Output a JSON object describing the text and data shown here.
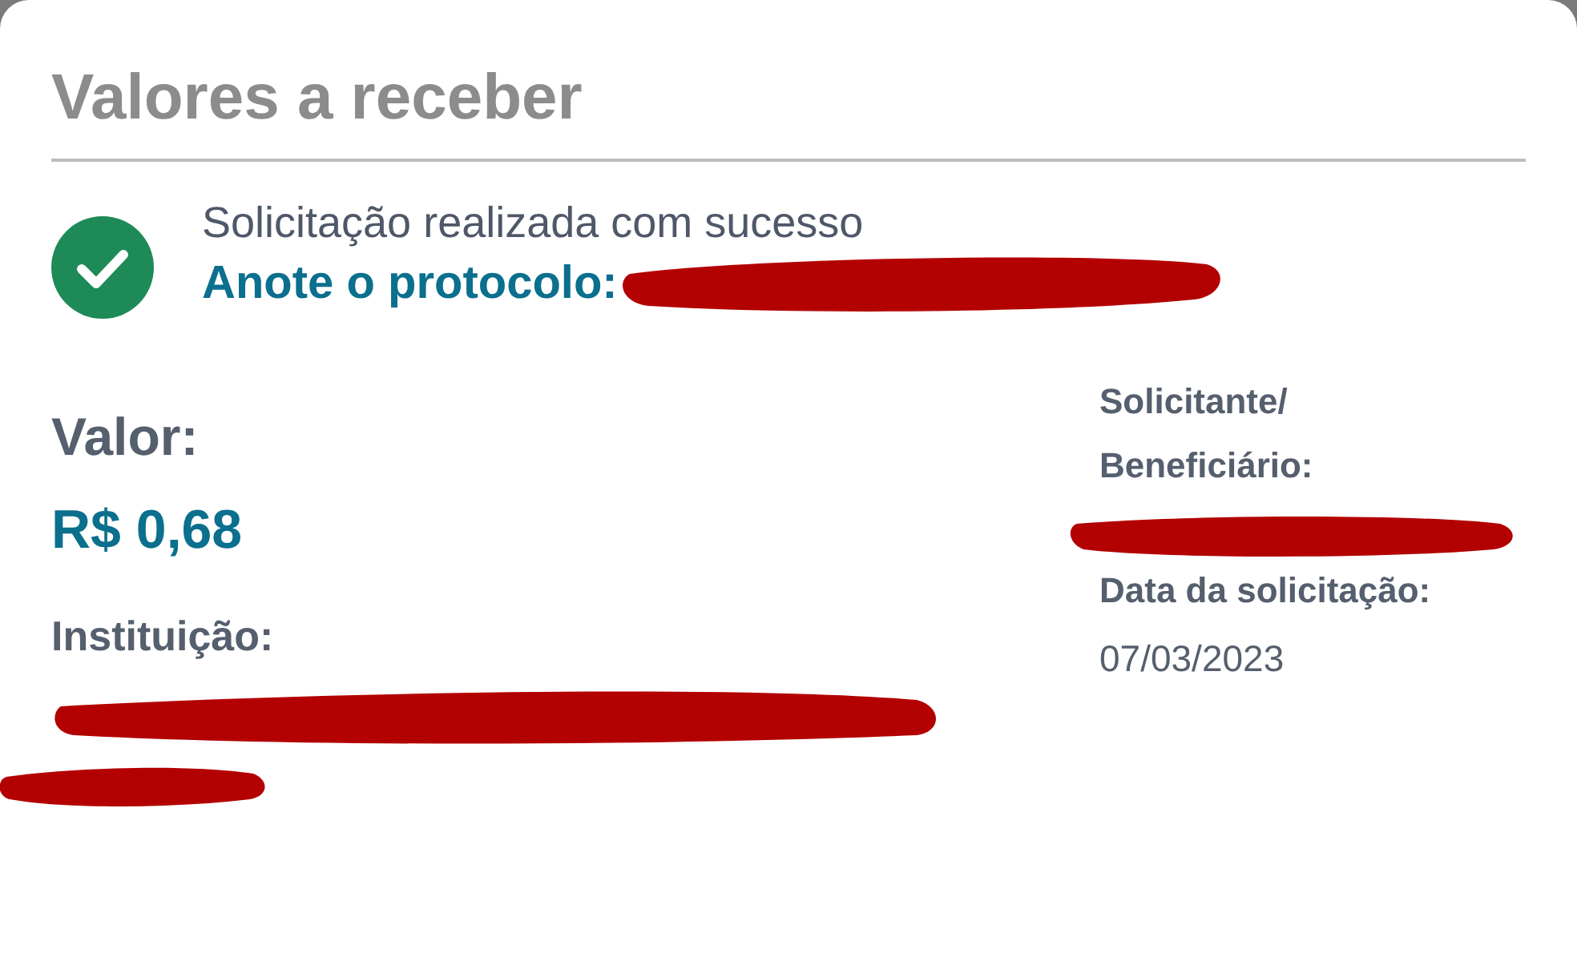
{
  "title": "Valores a receber",
  "status": {
    "kind": "success",
    "message": "Solicitação realizada com sucesso",
    "protocol_label": "Anote o protocolo:"
  },
  "value": {
    "label": "Valor:",
    "amount": "R$ 0,68"
  },
  "institution": {
    "label": "Instituição:"
  },
  "requester": {
    "label_lines": [
      "Solicitante/",
      "Beneficiário:"
    ]
  },
  "request_date": {
    "label": "Data da solicitação:",
    "value": "07/03/2023"
  }
}
